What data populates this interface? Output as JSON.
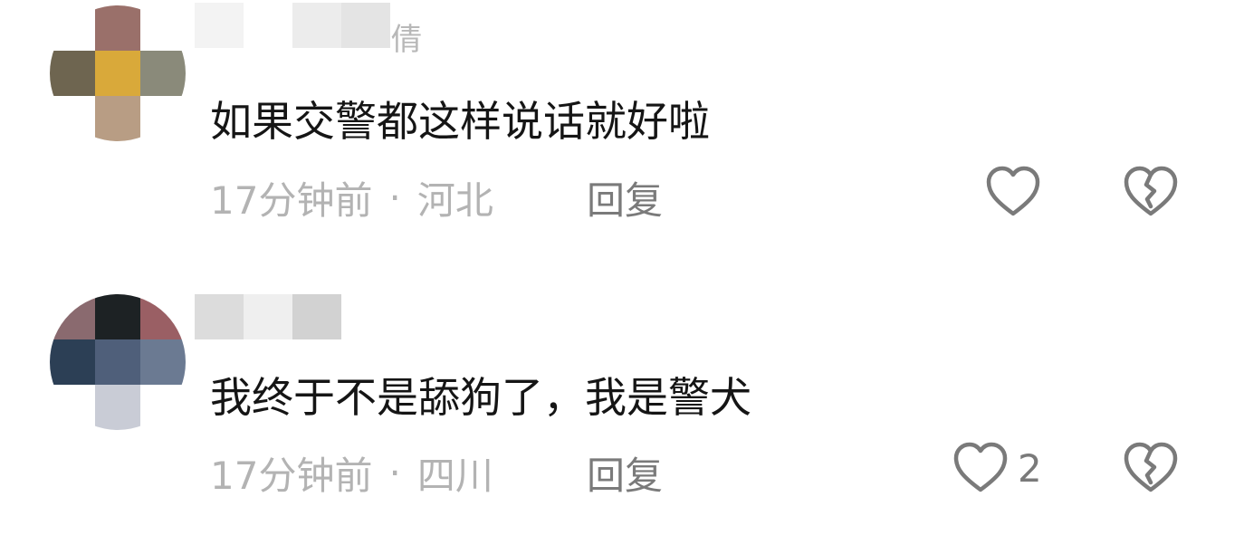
{
  "comments": [
    {
      "name_suffix": "倩",
      "text": "如果交警都这样说话就好啦",
      "time": "17分钟前",
      "separator": "·",
      "location": "河北",
      "reply_label": "回复",
      "like_count": "",
      "avatar_tiles": [
        "#ffffff",
        "#9a706a",
        "#ffffff",
        "#6e6550",
        "#d9a93a",
        "#8a8a7a",
        "#ffffff",
        "#b89d84",
        "#ffffff"
      ],
      "name_tiles": [
        "#f3f3f3",
        "#ffffff",
        "#ececec",
        "#e4e4e4"
      ]
    },
    {
      "name_suffix": "",
      "text": "我终于不是舔狗了，我是警犬",
      "time": "17分钟前",
      "separator": "·",
      "location": "四川",
      "reply_label": "回复",
      "like_count": "2",
      "avatar_tiles": [
        "#8a6a6f",
        "#1d2224",
        "#9a5f64",
        "#2c3f55",
        "#4f5f7a",
        "#6b7a92",
        "#ffffff",
        "#c9ccd6",
        "#ffffff"
      ],
      "name_tiles": [
        "#dcdcdc",
        "#efefef",
        "#d2d2d2",
        "#ffffff"
      ]
    }
  ],
  "icons": {
    "like": "heart-outline-icon",
    "dislike": "broken-heart-icon"
  },
  "colors": {
    "text": "#151515",
    "meta": "#b3b3b3",
    "action": "#7a7a7a"
  }
}
